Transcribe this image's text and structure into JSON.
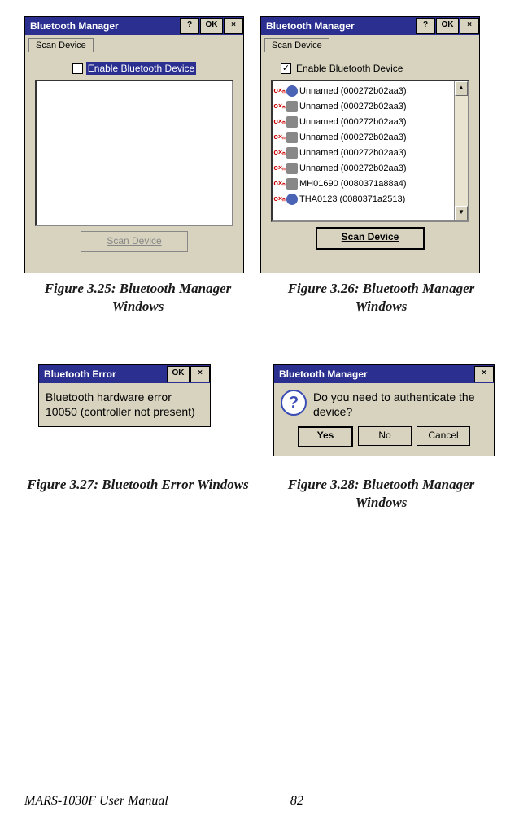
{
  "footer": {
    "manual": "MARS-1030F User Manual",
    "page": "82"
  },
  "figs": {
    "c25": "Figure 3.25:  Bluetooth Manager Windows",
    "c26": "Figure 3.26:  Bluetooth Manager Windows",
    "c27": "Figure 3.27:  Bluetooth Error Windows",
    "c28": "Figure 3.28:  Bluetooth Manager Windows"
  },
  "common": {
    "title": "Bluetooth Manager",
    "help": "?",
    "ok": "OK",
    "close": "×",
    "tab": "Scan Device",
    "checkbox_label": "Enable Bluetooth Device",
    "scan_btn": "Scan Device",
    "up": "▲",
    "down": "▼",
    "checkmark": "✓"
  },
  "fig26_devices": [
    {
      "name": "Unnamed (000272b02aa3)",
      "type": "blue"
    },
    {
      "name": "Unnamed (000272b02aa3)",
      "type": "grey"
    },
    {
      "name": "Unnamed (000272b02aa3)",
      "type": "grey"
    },
    {
      "name": "Unnamed (000272b02aa3)",
      "type": "grey"
    },
    {
      "name": "Unnamed (000272b02aa3)",
      "type": "grey"
    },
    {
      "name": "Unnamed (000272b02aa3)",
      "type": "grey"
    },
    {
      "name": "MH01690 (0080371a88a4)",
      "type": "grey"
    },
    {
      "name": "THA0123 (0080371a2513)",
      "type": "blue"
    }
  ],
  "fig27": {
    "title": "Bluetooth Error",
    "ok": "OK",
    "close": "×",
    "msg": "Bluetooth hardware error 10050 (controller not present)"
  },
  "fig28": {
    "title": "Bluetooth Manager",
    "close": "×",
    "msg": "Do you need to authenticate the device?",
    "yes": "Yes",
    "no": "No",
    "cancel": "Cancel",
    "q": "?"
  }
}
